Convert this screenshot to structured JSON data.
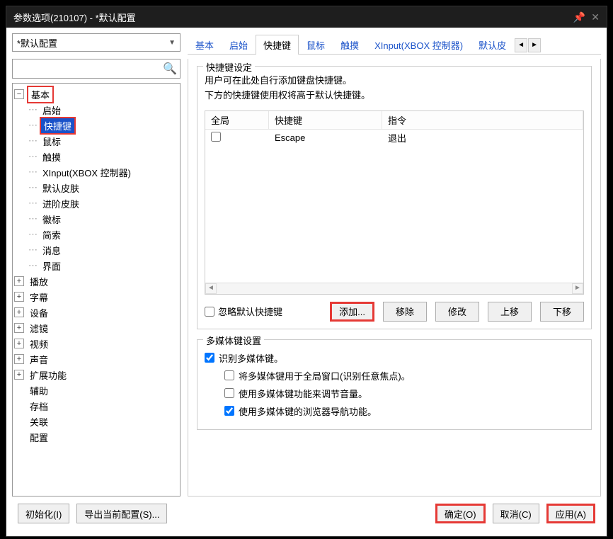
{
  "window": {
    "title": "参数选项(210107) - *默认配置"
  },
  "combo": {
    "value": "*默认配置"
  },
  "search": {
    "placeholder": ""
  },
  "tabs": {
    "items": [
      "基本",
      "启始",
      "快捷键",
      "鼠标",
      "触摸",
      "XInput(XBOX 控制器)",
      "默认皮"
    ],
    "activeIndex": 2
  },
  "tree": {
    "basic": "基本",
    "children": {
      "start": "启始",
      "hotkey": "快捷键",
      "mouse": "鼠标",
      "touch": "触摸",
      "xinput": "XInput(XBOX 控制器)",
      "defaultSkin": "默认皮肤",
      "advancedSkin": "进阶皮肤",
      "badge": "徽标",
      "brief": "简索",
      "message": "消息",
      "ui": "界面"
    },
    "siblings": {
      "playback": "播放",
      "subtitle": "字幕",
      "device": "设备",
      "filter": "滤镜",
      "video": "视频",
      "audio": "声音",
      "extension": "扩展功能",
      "assist": "辅助",
      "archive": "存档",
      "associate": "关联",
      "config": "配置"
    }
  },
  "hotkey": {
    "legend": "快捷键设定",
    "desc1": "用户可在此处自行添加键盘快捷键。",
    "desc2": "下方的快捷键使用权将高于默认快捷键。",
    "columns": {
      "global": "全局",
      "key": "快捷键",
      "command": "指令"
    },
    "rows": [
      {
        "global": false,
        "key": "Escape",
        "command": "退出"
      }
    ],
    "ignore_label": "忽略默认快捷键",
    "buttons": {
      "add": "添加...",
      "remove": "移除",
      "modify": "修改",
      "up": "上移",
      "down": "下移"
    }
  },
  "multimedia": {
    "legend": "多媒体键设置",
    "recognize": "识别多媒体键。",
    "globalWindow": "将多媒体键用于全局窗口(识别任意焦点)。",
    "volume": "使用多媒体键功能来调节音量。",
    "browserNav": "使用多媒体键的浏览器导航功能。"
  },
  "footer": {
    "init": "初始化(I)",
    "export": "导出当前配置(S)...",
    "ok": "确定(O)",
    "cancel": "取消(C)",
    "apply": "应用(A)"
  }
}
